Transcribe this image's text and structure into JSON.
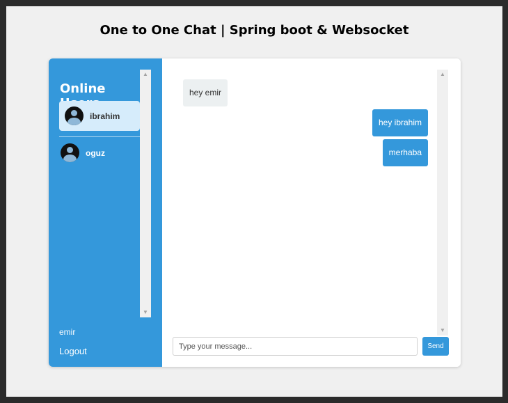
{
  "page": {
    "title": "One to One Chat | Spring boot & Websocket"
  },
  "sidebar": {
    "heading": "Online Users",
    "users": [
      {
        "name": "ibrahim",
        "active": true
      },
      {
        "name": "oguz",
        "active": false
      }
    ],
    "current_user": "emir",
    "logout_label": "Logout"
  },
  "chat": {
    "messages": [
      {
        "text": "hey emir",
        "direction": "received"
      },
      {
        "text": "hey ibrahim",
        "direction": "sent"
      },
      {
        "text": "merhaba",
        "direction": "sent"
      }
    ],
    "input": {
      "value": "",
      "placeholder": "Type your message..."
    },
    "send_label": "Send"
  },
  "colors": {
    "accent": "#3498db",
    "active_user_bg": "#d6ecfb",
    "received_bubble": "#ecf0f1",
    "page_bg": "#f0f0f0"
  },
  "scrollbar_icons": {
    "up": "triangle-up-icon",
    "down": "triangle-down-icon"
  }
}
